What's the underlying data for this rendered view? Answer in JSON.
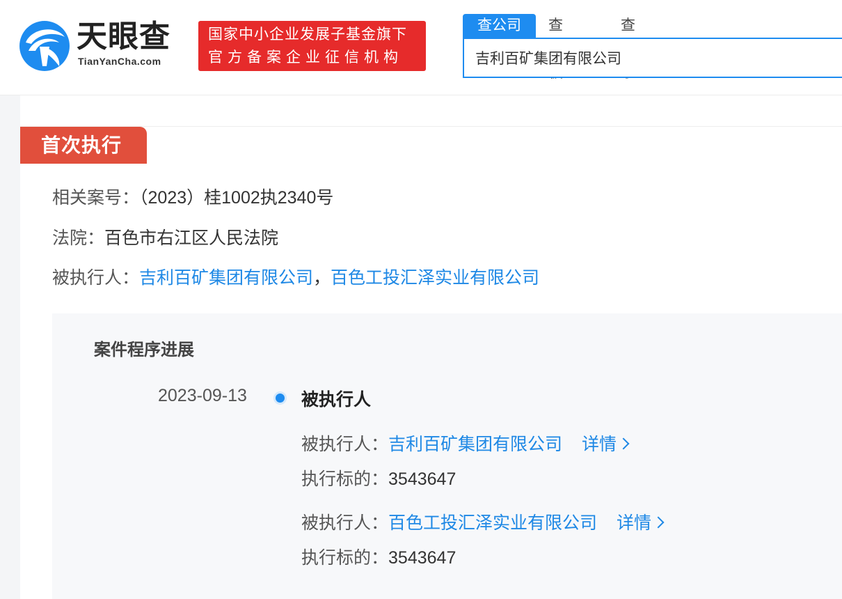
{
  "header": {
    "logo_title": "天眼查",
    "logo_sub": "TianYanCha.com",
    "banner_line1": "国家中小企业发展子基金旗下",
    "banner_line2": "官方备案企业征信机构",
    "tabs": [
      "查公司",
      "查老板",
      "查关系"
    ],
    "search_value": "吉利百矿集团有限公司"
  },
  "section": {
    "tag": "首次执行",
    "case_label": "相关案号：",
    "case_value": "（2023）桂1002执2340号",
    "court_label": "法院：",
    "court_value": "百色市右江区人民法院",
    "executed_label": "被执行人：",
    "executed_1": "吉利百矿集团有限公司",
    "separator": "，",
    "executed_2": "百色工投汇泽实业有限公司"
  },
  "timeline": {
    "title": "案件程序进展",
    "date": "2023-09-13",
    "event": "被执行人",
    "entries": [
      {
        "party_label": "被执行人：",
        "party": "吉利百矿集团有限公司",
        "detail": "详情",
        "amount_label": "执行标的：",
        "amount": "3543647"
      },
      {
        "party_label": "被执行人：",
        "party": "百色工投汇泽实业有限公司",
        "detail": "详情",
        "amount_label": "执行标的：",
        "amount": "3543647"
      }
    ]
  },
  "colors": {
    "brand_blue": "#1e8cf0",
    "banner_red": "#e62b2b",
    "tag_red": "#e14f3c",
    "link": "#1e88e5"
  },
  "icons": [
    "tianyancha-logo-icon",
    "chevron-right-icon",
    "timeline-dot-icon"
  ]
}
